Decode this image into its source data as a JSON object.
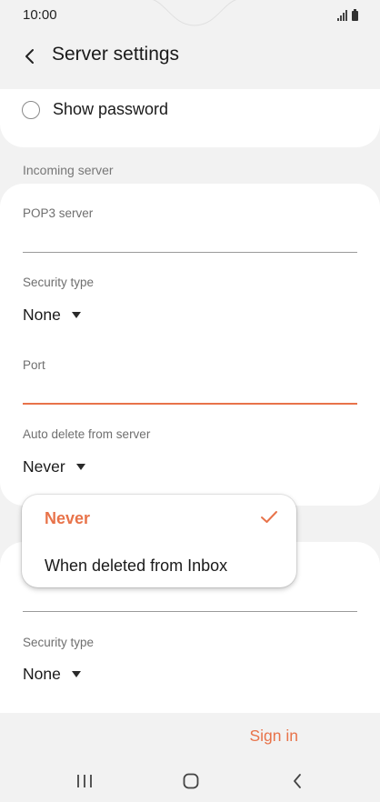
{
  "status_bar": {
    "time": "10:00",
    "icons": [
      "signal-icon",
      "battery-icon"
    ]
  },
  "header": {
    "title": "Server settings",
    "back_icon": "chevron-left-icon"
  },
  "show_password": {
    "label": "Show password",
    "checked": false
  },
  "incoming_server": {
    "section_label": "Incoming server",
    "pop3_server": {
      "label": "POP3 server",
      "value": ""
    },
    "security_type": {
      "label": "Security type",
      "value": "None"
    },
    "port": {
      "label": "Port",
      "value": ""
    },
    "auto_delete": {
      "label": "Auto delete from server",
      "value": "Never"
    }
  },
  "dropdown": {
    "options": [
      {
        "label": "Never",
        "selected": true
      },
      {
        "label": "When deleted from Inbox",
        "selected": false
      }
    ]
  },
  "outgoing_server": {
    "security_type": {
      "label": "Security type",
      "value": "None"
    }
  },
  "actions": {
    "sign_in": "Sign in"
  },
  "nav_bar": {
    "buttons": [
      "recent-apps-icon",
      "home-icon",
      "back-icon"
    ]
  },
  "colors": {
    "accent": "#e8734a",
    "background": "#f2f2f2",
    "card": "#ffffff"
  }
}
